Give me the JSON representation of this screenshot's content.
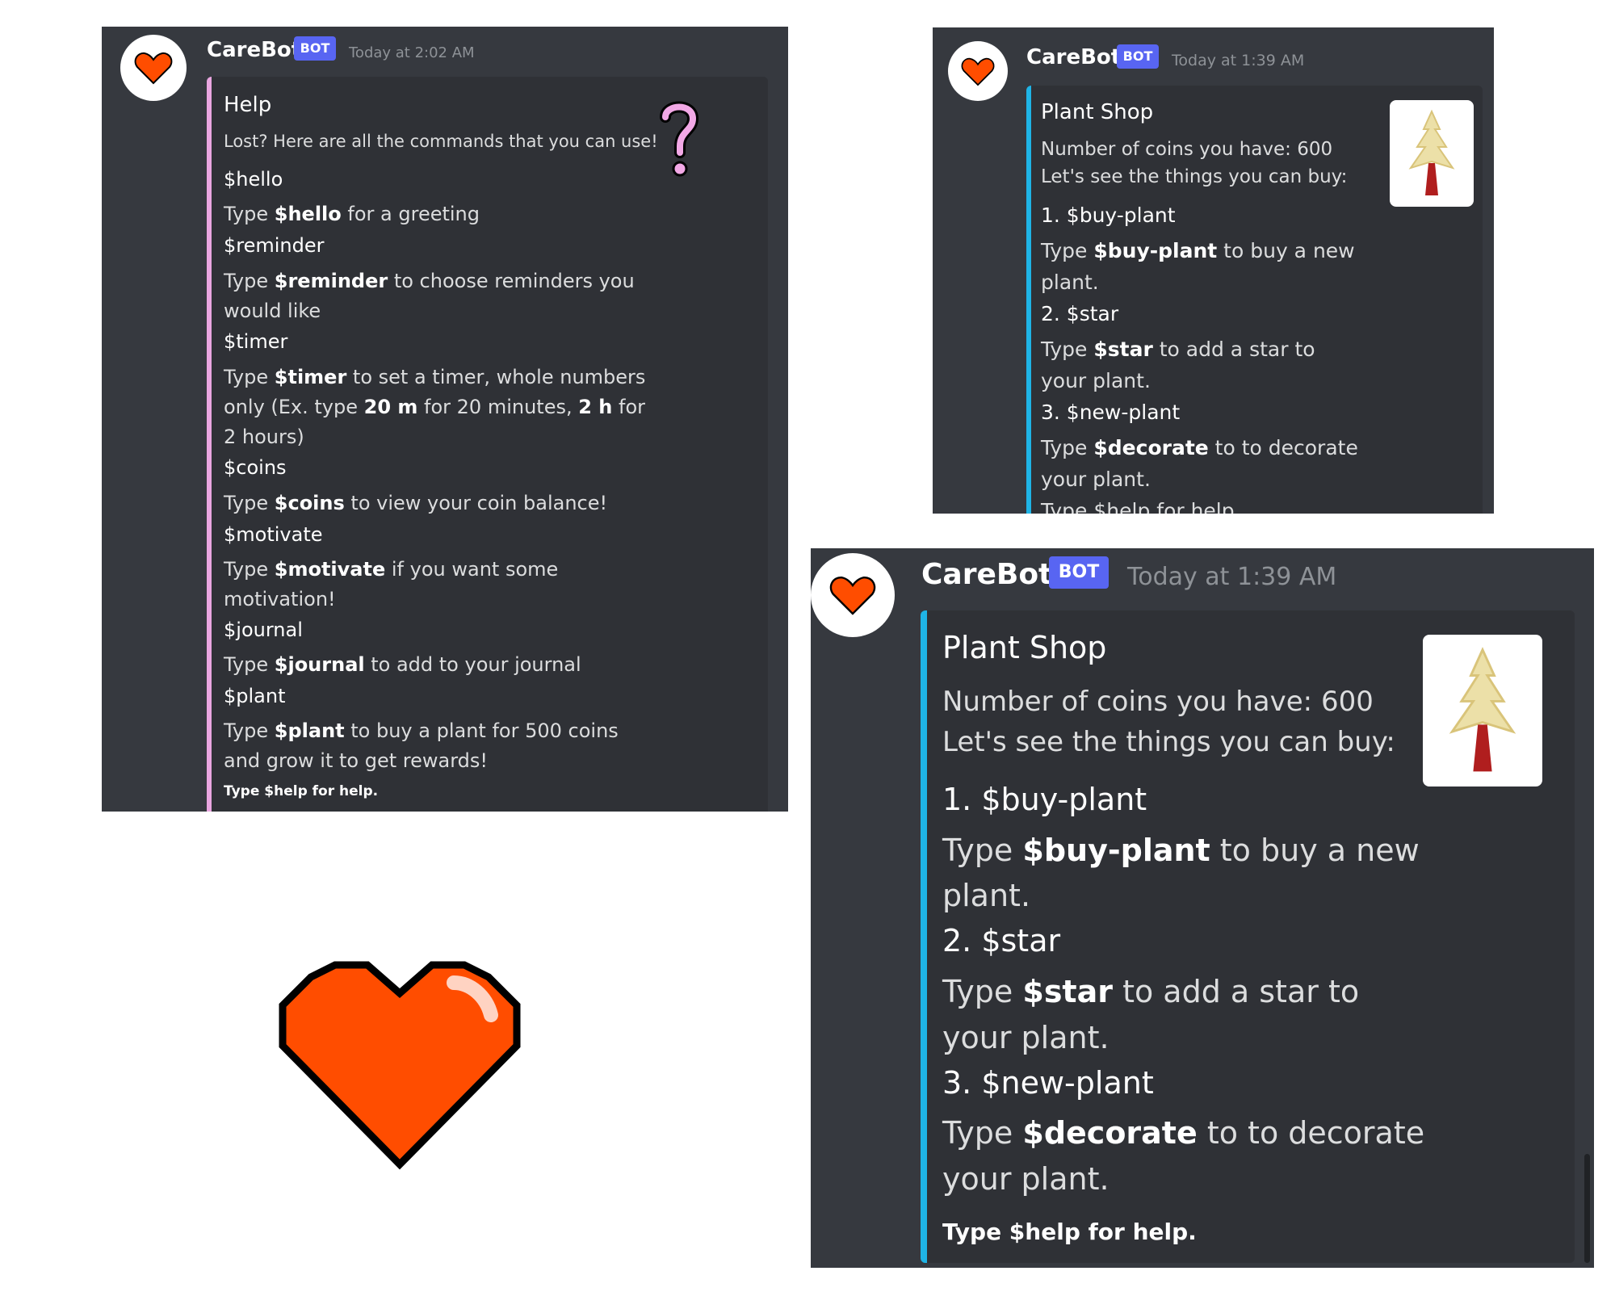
{
  "bot": {
    "name": "CareBot",
    "badge": "BOT"
  },
  "colors": {
    "panel": "#36393f",
    "embed": "#2f3136",
    "help_accent": "#e9a6e0",
    "shop_accent": "#1fb4e6",
    "heart": "#ff4d00",
    "badge": "#5865f2"
  },
  "help": {
    "timestamp": "Today at 2:02 AM",
    "title": "Help",
    "intro": "Lost? Here are all the commands that you can use!",
    "icon": "question-mark-icon",
    "lines": {
      "hello_cmd": "$hello",
      "hello_pre": "Type ",
      "hello_bold": "$hello",
      "hello_post": " for a greeting",
      "reminder_cmd": "$reminder",
      "reminder_pre": "Type ",
      "reminder_bold": "$reminder",
      "reminder_post": " to choose reminders you",
      "reminder_cont": "would like",
      "timer_cmd": "$timer",
      "timer_pre": "Type ",
      "timer_bold": "$timer",
      "timer_post": " to set a timer, whole numbers",
      "timer2_pre": "only (Ex. type ",
      "timer2_bold1": "20 m",
      "timer2_mid": " for 20 minutes, ",
      "timer2_bold2": "2 h",
      "timer2_post": " for",
      "timer_cont": "2 hours)",
      "coins_cmd": "$coins",
      "coins_pre": "Type ",
      "coins_bold": "$coins",
      "coins_post": " to view your coin balance!",
      "motivate_cmd": "$motivate",
      "motivate_pre": "Type ",
      "motivate_bold": "$motivate",
      "motivate_post": " if you want some",
      "motivate_cont": "motivation!",
      "journal_cmd": "$journal",
      "journal_pre": "Type ",
      "journal_bold": "$journal",
      "journal_post": " to add to your journal",
      "plant_cmd": "$plant",
      "plant_pre": "Type ",
      "plant_bold": "$plant",
      "plant_post": " to buy a plant for 500 coins",
      "plant_cont": "and grow it to get rewards!"
    },
    "footer": "Type $help for help."
  },
  "shop": {
    "timestamp": "Today at 1:39 AM",
    "title": "Plant Shop",
    "coins_line": "Number of coins you have: 600",
    "intro": "Let's see the things you can buy:",
    "thumbnail": "tree-icon",
    "item1_cmd": "1. $buy-plant",
    "item1_pre": "Type ",
    "item1_bold": "$buy-plant",
    "item1_post": " to buy a new",
    "item1_cont": "plant.",
    "item2_cmd": "2. $star",
    "item2_pre": "Type ",
    "item2_bold": "$star",
    "item2_post": " to add a star to",
    "item2_cont": "your plant.",
    "item3_cmd": "3. $new-plant",
    "item3_pre": "Type ",
    "item3_bold": "$decorate",
    "item3_post": " to to decorate",
    "item3_cont": "your plant.",
    "cut_line": "Type $help for help.",
    "footer": "Type $help for help."
  },
  "standalone_heart": "heart-icon"
}
